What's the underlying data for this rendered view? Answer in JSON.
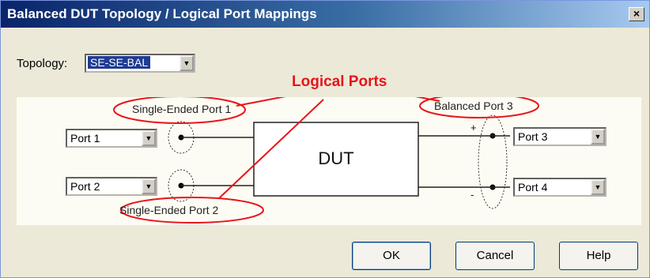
{
  "window": {
    "title": "Balanced DUT Topology / Logical Port Mappings",
    "close_glyph": "×"
  },
  "topology": {
    "label": "Topology:",
    "value": "SE-SE-BAL"
  },
  "diagram": {
    "dut_label": "DUT",
    "annotation": "Logical Ports",
    "se_port_1": "Single-Ended Port 1",
    "se_port_2": "Single-Ended Port 2",
    "balanced_port_3": "Balanced Port 3",
    "plus": "+",
    "minus": "-",
    "annotation_color": "#e8141b"
  },
  "port_selects": {
    "left_top": "Port 1",
    "left_bottom": "Port 2",
    "right_top": "Port 3",
    "right_bottom": "Port 4"
  },
  "buttons": {
    "ok": "OK",
    "cancel": "Cancel",
    "help": "Help"
  }
}
